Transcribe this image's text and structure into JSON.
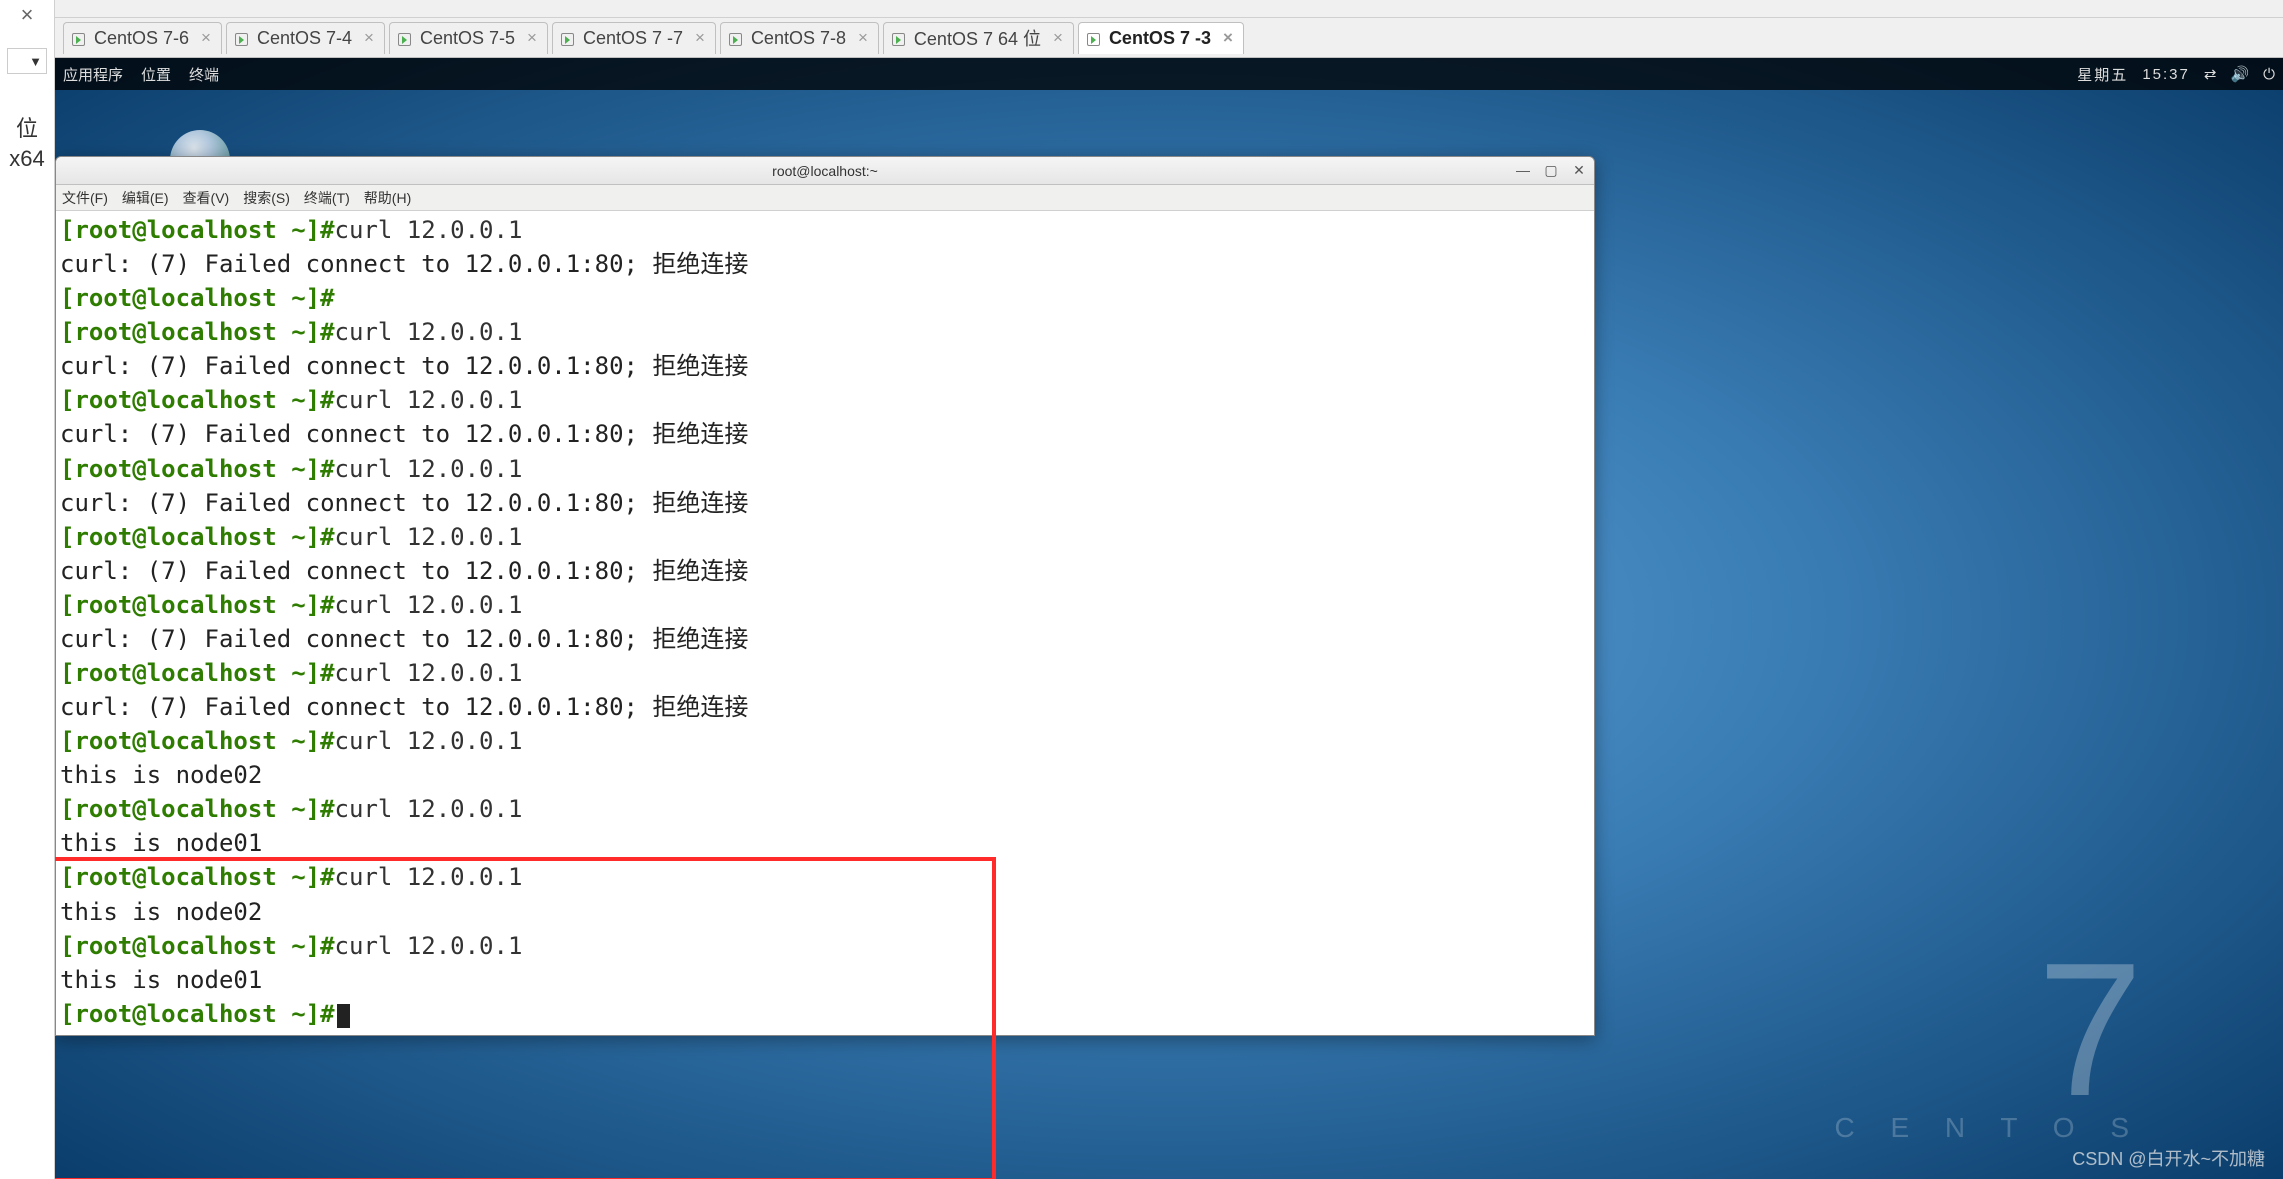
{
  "leftPanel": {
    "close": "×",
    "dropdown": "▼",
    "line1": "位",
    "line2": "x64"
  },
  "tabs": [
    {
      "label": "CentOS 7-6",
      "active": false
    },
    {
      "label": "CentOS 7-4",
      "active": false
    },
    {
      "label": "CentOS 7-5",
      "active": false
    },
    {
      "label": "CentOS 7 -7",
      "active": false
    },
    {
      "label": "CentOS 7-8",
      "active": false
    },
    {
      "label": "CentOS 7 64 位",
      "active": false
    },
    {
      "label": "CentOS 7 -3",
      "active": true
    }
  ],
  "gnome": {
    "apps": "应用程序",
    "places": "位置",
    "terminal": "终端",
    "clockDay": "星期五",
    "clockTime": "15:37"
  },
  "termWindow": {
    "title": "root@localhost:~",
    "menus": [
      "文件(F)",
      "编辑(E)",
      "查看(V)",
      "搜索(S)",
      "终端(T)",
      "帮助(H)"
    ],
    "prompt": "[root@localhost ~]#",
    "lines": [
      {
        "t": "p",
        "cmd": "curl  12.0.0.1"
      },
      {
        "t": "o",
        "text": "curl: (7) Failed connect to 12.0.0.1:80; 拒绝连接"
      },
      {
        "t": "p",
        "cmd": ""
      },
      {
        "t": "p",
        "cmd": "curl  12.0.0.1"
      },
      {
        "t": "o",
        "text": "curl: (7) Failed connect to 12.0.0.1:80; 拒绝连接"
      },
      {
        "t": "p",
        "cmd": "curl  12.0.0.1"
      },
      {
        "t": "o",
        "text": "curl: (7) Failed connect to 12.0.0.1:80; 拒绝连接"
      },
      {
        "t": "p",
        "cmd": "curl 12.0.0.1"
      },
      {
        "t": "o",
        "text": "curl: (7) Failed connect to 12.0.0.1:80; 拒绝连接"
      },
      {
        "t": "p",
        "cmd": "curl 12.0.0.1"
      },
      {
        "t": "o",
        "text": "curl: (7) Failed connect to 12.0.0.1:80; 拒绝连接"
      },
      {
        "t": "p",
        "cmd": "curl 12.0.0.1"
      },
      {
        "t": "o",
        "text": "curl: (7) Failed connect to 12.0.0.1:80; 拒绝连接"
      },
      {
        "t": "p",
        "cmd": "curl  12.0.0.1"
      },
      {
        "t": "o",
        "text": "curl: (7) Failed connect to 12.0.0.1:80; 拒绝连接"
      },
      {
        "t": "p",
        "cmd": "curl  12.0.0.1"
      },
      {
        "t": "o",
        "text": "this is node02"
      },
      {
        "t": "p",
        "cmd": "curl  12.0.0.1"
      },
      {
        "t": "o",
        "text": "this is node01"
      },
      {
        "t": "p",
        "cmd": "curl  12.0.0.1"
      },
      {
        "t": "o",
        "text": "this is node02"
      },
      {
        "t": "p",
        "cmd": "curl  12.0.0.1"
      },
      {
        "t": "o",
        "text": "this is node01"
      },
      {
        "t": "p",
        "cmd": "",
        "cursor": true
      }
    ]
  },
  "branding": {
    "seven": "7",
    "centos": "C E N T O S"
  },
  "watermark": "CSDN @白开水~不加糖"
}
